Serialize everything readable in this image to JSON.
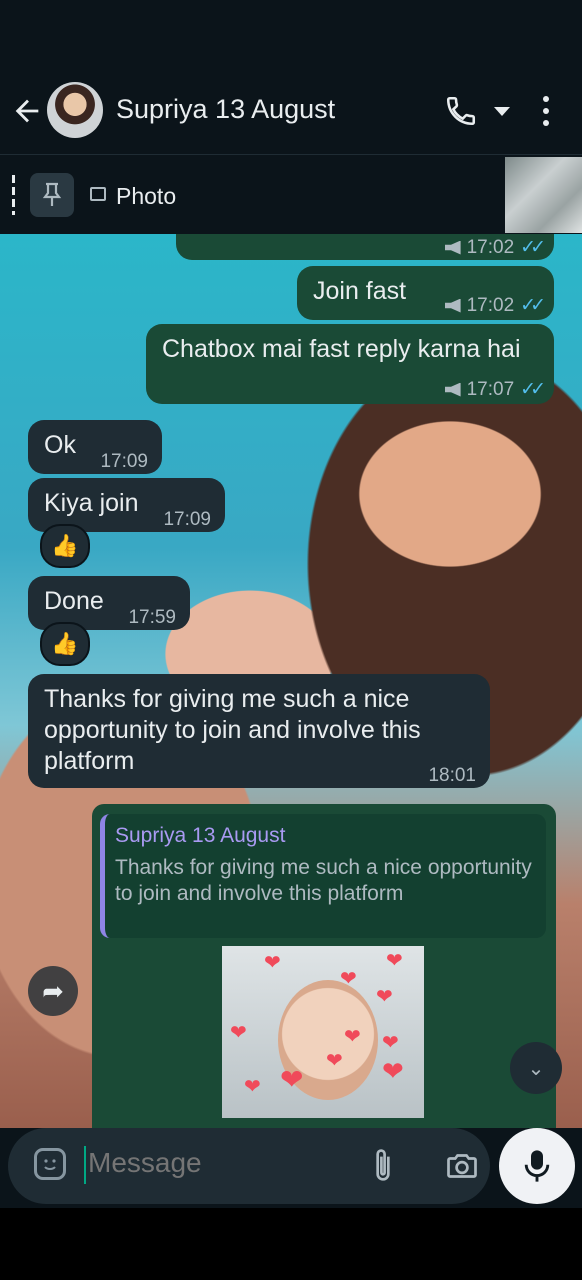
{
  "header": {
    "contact_name": "Supriya 13 August"
  },
  "pinned": {
    "label": "Photo"
  },
  "messages": [
    {
      "time": "17:02"
    },
    {
      "text": "Join fast",
      "time": "17:02"
    },
    {
      "text": "Chatbox mai fast reply karna hai",
      "time": "17:07"
    },
    {
      "text": "Ok",
      "time": "17:09"
    },
    {
      "text": "Kiya join",
      "time": "17:09",
      "reaction": "👍"
    },
    {
      "text": "Done",
      "time": "17:59",
      "reaction": "👍"
    },
    {
      "text": "Thanks for giving me such a nice opportunity to join and involve this platform",
      "time": "18:01"
    }
  ],
  "reply": {
    "quoted_name": "Supriya 13 August",
    "quoted_text": "Thanks for giving me such a nice opportunity to join and involve this platform"
  },
  "composer": {
    "placeholder": "Message"
  },
  "colors": {
    "outgoing_bubble": "#1a4a36",
    "incoming_bubble": "#1f2c34",
    "read_ticks": "#53bdeb",
    "quote_accent": "#8f85e6"
  }
}
